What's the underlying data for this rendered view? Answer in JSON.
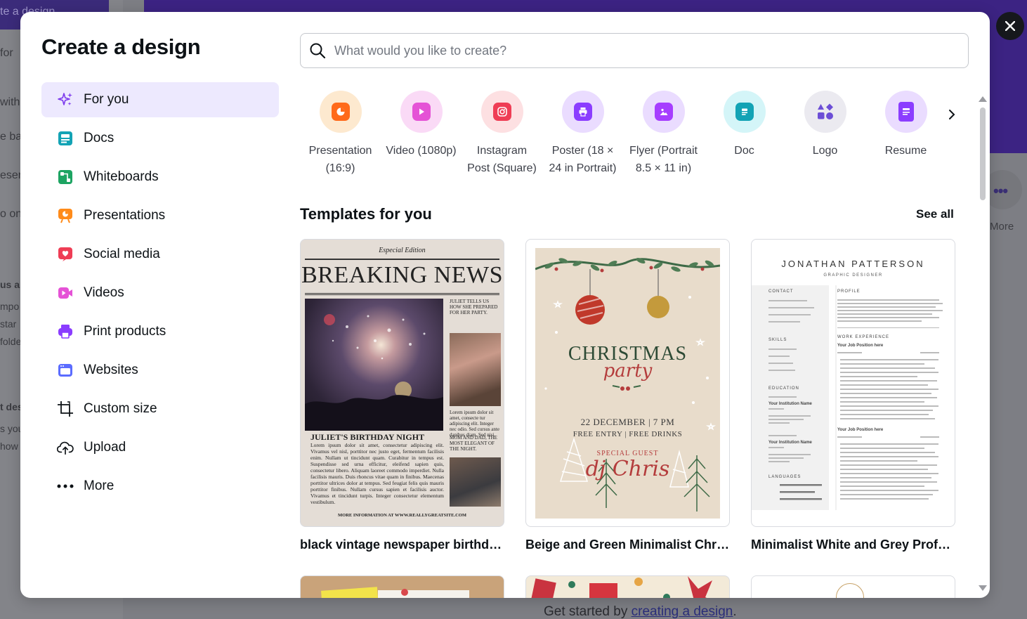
{
  "background": {
    "left_lines": [
      "te a design",
      "for",
      "with",
      "e ba",
      "esen",
      "o on",
      "us ar",
      "mpo",
      "star",
      "folde",
      "t des",
      "s you",
      "how"
    ],
    "more_label": "More",
    "footer_prefix": "Get started by ",
    "footer_link": "creating a design",
    "footer_suffix": "."
  },
  "modal": {
    "title": "Create a design",
    "close_icon": "close-icon",
    "search": {
      "placeholder": "What would you like to create?",
      "value": ""
    },
    "nav": [
      {
        "label": "For you",
        "icon": "sparkles-icon",
        "color": "#7c3aed",
        "active": true
      },
      {
        "label": "Docs",
        "icon": "docs-icon",
        "color": "#13a3b5"
      },
      {
        "label": "Whiteboards",
        "icon": "whiteboard-icon",
        "color": "#1da462"
      },
      {
        "label": "Presentations",
        "icon": "presentation-icon",
        "color": "#ff8b1a"
      },
      {
        "label": "Social media",
        "icon": "heart-icon",
        "color": "#ef3d55"
      },
      {
        "label": "Videos",
        "icon": "video-icon",
        "color": "#e552d6"
      },
      {
        "label": "Print products",
        "icon": "printer-icon",
        "color": "#8b3dff"
      },
      {
        "label": "Websites",
        "icon": "website-icon",
        "color": "#5b6cff"
      },
      {
        "label": "Custom size",
        "icon": "crop-icon",
        "color": "#0d1216"
      },
      {
        "label": "Upload",
        "icon": "cloud-upload-icon",
        "color": "#0d1216"
      },
      {
        "label": "More",
        "icon": "ellipsis-icon",
        "color": "#0d1216"
      }
    ],
    "design_types": [
      {
        "label_line1": "Presentation",
        "label_line2": "(16:9)",
        "icon": "presentation-icon",
        "bg": "#fde9cf",
        "color": "#ff6a1a"
      },
      {
        "label_line1": "Video (1080p)",
        "label_line2": "",
        "icon": "play-icon",
        "bg": "#fadaf6",
        "color": "#e552d6"
      },
      {
        "label_line1": "Instagram",
        "label_line2": "Post (Square)",
        "icon": "instagram-icon",
        "bg": "#fde0e2",
        "color": "#ef3d55"
      },
      {
        "label_line1": "Poster (18 ×",
        "label_line2": "24 in Portrait)",
        "icon": "printer-icon",
        "bg": "#eadcff",
        "color": "#8b3dff"
      },
      {
        "label_line1": "Flyer (Portrait",
        "label_line2": "8.5 × 11 in)",
        "icon": "image-doc-icon",
        "bg": "#eadcff",
        "color": "#a63dff"
      },
      {
        "label_line1": "Doc",
        "label_line2": "",
        "icon": "doc-icon",
        "bg": "#d4f5f8",
        "color": "#13a3b5"
      },
      {
        "label_line1": "Logo",
        "label_line2": "",
        "icon": "logo-shapes-icon",
        "bg": "#ebeaf0",
        "color": "#6c4ed6"
      },
      {
        "label_line1": "Resume",
        "label_line2": "",
        "icon": "resume-icon",
        "bg": "#eadcff",
        "color": "#8b3dff"
      }
    ],
    "next_icon": "chevron-right-icon",
    "section_title": "Templates for you",
    "see_all": "See all",
    "templates": [
      {
        "title": "black vintage newspaper birthda...",
        "thumb": {
          "edition": "Especial Edition",
          "headline": "BREAKING NEWS",
          "side": "Juliet tells us how she prepared for her party.",
          "side2": "Lorem ipsum dolor sit amet, consecte tur adipiscing elit. Integer nec odio. Sed cursus ante dapibus diam. Sed nisi.",
          "side3": "Mom and dad, the most elegant of the night.",
          "subhead": "JULIET'S BIRTHDAY NIGHT",
          "body": "Lorem ipsum dolor sit amet, consectetur adipiscing elit. Vivamus vel nisl, porttitor nec justo eget, fermentum facilisis enim. Nullam ut tincidunt quam. Curabitur in tempus est. Suspendisse sed urna efficitur, eleifend sapien quis, consectetur libero. Aliquam laoreet commodo imperdiet. Nulla facilisis mauris. Duis rhoncus vitae quam in finibus. Maecenas porttitor ultrices dolor at tempus. Sed feugiat felis quis mauris porttitor finibus. Nullam cursus sapien et facilisis auctor. Vivamus et tincidunt turpis. Integer consectetur elementum vestibulum.",
          "footer": "MORE INFORMATION AT WWW.REALLYGREATSITE.COM"
        }
      },
      {
        "title": "Beige and Green Minimalist Chri...",
        "thumb": {
          "title": "CHRISTMAS",
          "script": "party",
          "date": "22 DECEMBER | 7 PM",
          "entry": "FREE ENTRY | FREE DRINKS",
          "guest": "SPECIAL GUEST",
          "dj": "dj Chris"
        }
      },
      {
        "title": "Minimalist White and Grey Profe...",
        "thumb": {
          "name": "JONATHAN PATTERSON",
          "role": "GRAPHIC DESIGNER",
          "contact": "CONTACT",
          "skills": "SKILLS",
          "education": "EDUCATION",
          "languages": "LANGUAGES",
          "profile": "PROFILE",
          "experience": "WORK EXPERIENCE",
          "job1": "Your Job Position here",
          "job2": "Your Job Position here",
          "institution1": "Your Institution Name",
          "institution2": "Your Institution Name"
        }
      }
    ]
  }
}
